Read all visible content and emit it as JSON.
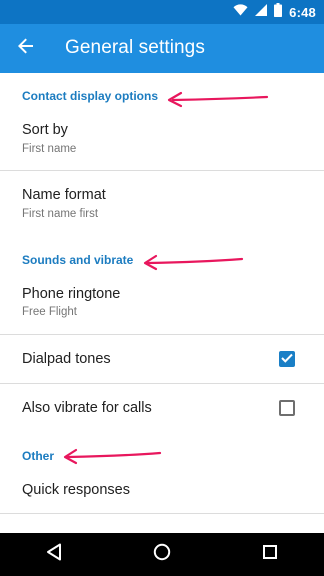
{
  "status_bar": {
    "time": "6:48",
    "icons": [
      "wifi-icon",
      "signal-icon",
      "battery-icon"
    ]
  },
  "app_bar": {
    "back_icon": "arrow-back-icon",
    "title": "General settings"
  },
  "sections": {
    "contact_display": {
      "header": "Contact display options",
      "sort_by": {
        "title": "Sort by",
        "value": "First name"
      },
      "name_format": {
        "title": "Name format",
        "value": "First name first"
      }
    },
    "sounds": {
      "header": "Sounds and vibrate",
      "phone_ringtone": {
        "title": "Phone ringtone",
        "value": "Free Flight"
      },
      "dialpad_tones": {
        "title": "Dialpad tones",
        "checked": true
      },
      "vibrate_calls": {
        "title": "Also vibrate for calls",
        "checked": false
      }
    },
    "other": {
      "header": "Other",
      "quick_responses": {
        "title": "Quick responses"
      }
    }
  },
  "annotations": {
    "arrow_color": "#e8175d",
    "count": 3
  },
  "nav_bar": {
    "icons": [
      "back-triangle-icon",
      "home-circle-icon",
      "recents-square-icon"
    ]
  },
  "colors": {
    "status_bar": "#0d74c4",
    "app_bar": "#1f8ee0",
    "accent": "#1c7cc0"
  }
}
